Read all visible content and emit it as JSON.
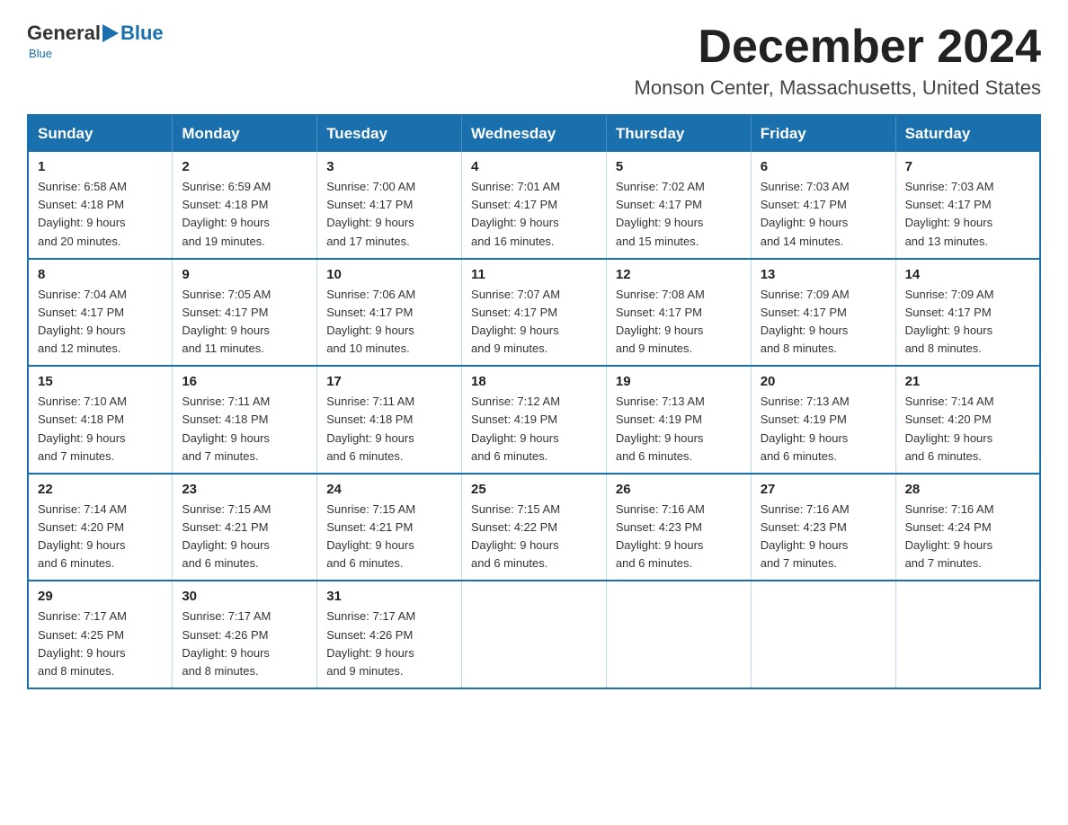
{
  "logo": {
    "general": "General",
    "blue": "Blue",
    "subtitle": "Blue"
  },
  "header": {
    "title": "December 2024",
    "subtitle": "Monson Center, Massachusetts, United States"
  },
  "days_of_week": [
    "Sunday",
    "Monday",
    "Tuesday",
    "Wednesday",
    "Thursday",
    "Friday",
    "Saturday"
  ],
  "weeks": [
    [
      {
        "day": "1",
        "sunrise": "6:58 AM",
        "sunset": "4:18 PM",
        "daylight": "9 hours and 20 minutes."
      },
      {
        "day": "2",
        "sunrise": "6:59 AM",
        "sunset": "4:18 PM",
        "daylight": "9 hours and 19 minutes."
      },
      {
        "day": "3",
        "sunrise": "7:00 AM",
        "sunset": "4:17 PM",
        "daylight": "9 hours and 17 minutes."
      },
      {
        "day": "4",
        "sunrise": "7:01 AM",
        "sunset": "4:17 PM",
        "daylight": "9 hours and 16 minutes."
      },
      {
        "day": "5",
        "sunrise": "7:02 AM",
        "sunset": "4:17 PM",
        "daylight": "9 hours and 15 minutes."
      },
      {
        "day": "6",
        "sunrise": "7:03 AM",
        "sunset": "4:17 PM",
        "daylight": "9 hours and 14 minutes."
      },
      {
        "day": "7",
        "sunrise": "7:03 AM",
        "sunset": "4:17 PM",
        "daylight": "9 hours and 13 minutes."
      }
    ],
    [
      {
        "day": "8",
        "sunrise": "7:04 AM",
        "sunset": "4:17 PM",
        "daylight": "9 hours and 12 minutes."
      },
      {
        "day": "9",
        "sunrise": "7:05 AM",
        "sunset": "4:17 PM",
        "daylight": "9 hours and 11 minutes."
      },
      {
        "day": "10",
        "sunrise": "7:06 AM",
        "sunset": "4:17 PM",
        "daylight": "9 hours and 10 minutes."
      },
      {
        "day": "11",
        "sunrise": "7:07 AM",
        "sunset": "4:17 PM",
        "daylight": "9 hours and 9 minutes."
      },
      {
        "day": "12",
        "sunrise": "7:08 AM",
        "sunset": "4:17 PM",
        "daylight": "9 hours and 9 minutes."
      },
      {
        "day": "13",
        "sunrise": "7:09 AM",
        "sunset": "4:17 PM",
        "daylight": "9 hours and 8 minutes."
      },
      {
        "day": "14",
        "sunrise": "7:09 AM",
        "sunset": "4:17 PM",
        "daylight": "9 hours and 8 minutes."
      }
    ],
    [
      {
        "day": "15",
        "sunrise": "7:10 AM",
        "sunset": "4:18 PM",
        "daylight": "9 hours and 7 minutes."
      },
      {
        "day": "16",
        "sunrise": "7:11 AM",
        "sunset": "4:18 PM",
        "daylight": "9 hours and 7 minutes."
      },
      {
        "day": "17",
        "sunrise": "7:11 AM",
        "sunset": "4:18 PM",
        "daylight": "9 hours and 6 minutes."
      },
      {
        "day": "18",
        "sunrise": "7:12 AM",
        "sunset": "4:19 PM",
        "daylight": "9 hours and 6 minutes."
      },
      {
        "day": "19",
        "sunrise": "7:13 AM",
        "sunset": "4:19 PM",
        "daylight": "9 hours and 6 minutes."
      },
      {
        "day": "20",
        "sunrise": "7:13 AM",
        "sunset": "4:19 PM",
        "daylight": "9 hours and 6 minutes."
      },
      {
        "day": "21",
        "sunrise": "7:14 AM",
        "sunset": "4:20 PM",
        "daylight": "9 hours and 6 minutes."
      }
    ],
    [
      {
        "day": "22",
        "sunrise": "7:14 AM",
        "sunset": "4:20 PM",
        "daylight": "9 hours and 6 minutes."
      },
      {
        "day": "23",
        "sunrise": "7:15 AM",
        "sunset": "4:21 PM",
        "daylight": "9 hours and 6 minutes."
      },
      {
        "day": "24",
        "sunrise": "7:15 AM",
        "sunset": "4:21 PM",
        "daylight": "9 hours and 6 minutes."
      },
      {
        "day": "25",
        "sunrise": "7:15 AM",
        "sunset": "4:22 PM",
        "daylight": "9 hours and 6 minutes."
      },
      {
        "day": "26",
        "sunrise": "7:16 AM",
        "sunset": "4:23 PM",
        "daylight": "9 hours and 6 minutes."
      },
      {
        "day": "27",
        "sunrise": "7:16 AM",
        "sunset": "4:23 PM",
        "daylight": "9 hours and 7 minutes."
      },
      {
        "day": "28",
        "sunrise": "7:16 AM",
        "sunset": "4:24 PM",
        "daylight": "9 hours and 7 minutes."
      }
    ],
    [
      {
        "day": "29",
        "sunrise": "7:17 AM",
        "sunset": "4:25 PM",
        "daylight": "9 hours and 8 minutes."
      },
      {
        "day": "30",
        "sunrise": "7:17 AM",
        "sunset": "4:26 PM",
        "daylight": "9 hours and 8 minutes."
      },
      {
        "day": "31",
        "sunrise": "7:17 AM",
        "sunset": "4:26 PM",
        "daylight": "9 hours and 9 minutes."
      },
      null,
      null,
      null,
      null
    ]
  ],
  "labels": {
    "sunrise": "Sunrise:",
    "sunset": "Sunset:",
    "daylight": "Daylight:"
  }
}
